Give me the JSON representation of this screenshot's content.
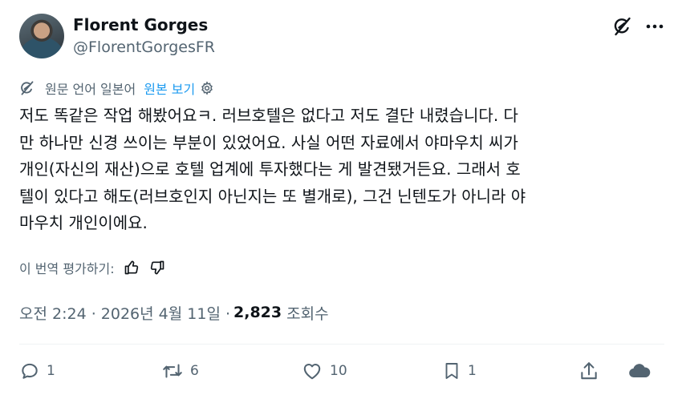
{
  "author": {
    "name": "Florent Gorges",
    "handle": "@FlorentGorgesFR"
  },
  "translation": {
    "label": "원문 언어 일본어",
    "link": "원본 보기"
  },
  "tweet": {
    "text": "저도 똑같은 작업 해봤어요ㅋ. 러브호텔은 없다고 저도 결단 내렸습니다. 다\n만 하나만 신경 쓰이는 부분이 있었어요. 사실 어떤 자료에서 야마우치 씨가\n개인(자신의 재산)으로 호텔 업계에 투자했다는 게 발견됐거든요. 그래서 호\n텔이 있다고 해도(러브호인지 아닌지는 또 별개로), 그건 닌텐도가 아니라 야\n마우치 개인이에요."
  },
  "rating": {
    "label": "이 번역 평가하기:"
  },
  "meta": {
    "timestamp": "오전 2:24 · 2026년 4월 11일 ·",
    "views": "2,823",
    "views_label": "조회수"
  },
  "actions": {
    "replies": "1",
    "reposts": "6",
    "likes": "10",
    "bookmarks": "1"
  },
  "colors": {
    "text": "#0f1419",
    "secondary": "#536471",
    "link": "#1d9bf0",
    "divider": "#eff3f4"
  }
}
